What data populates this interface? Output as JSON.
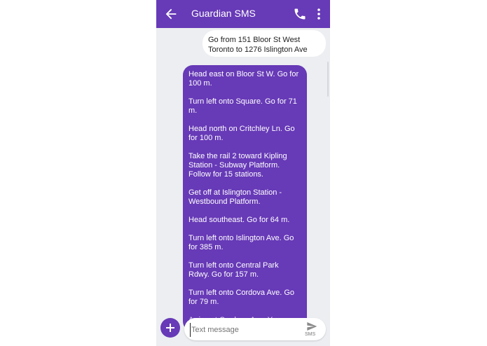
{
  "app": {
    "title": "Guardian SMS"
  },
  "thread": {
    "outgoing_message": "Go from 151 Bloor St West Toronto to 1276 Islington Ave",
    "incoming_steps": [
      "Head east on Bloor St W. Go for 100 m.",
      "Turn left onto Square. Go for 71 m.",
      "Head north on Critchley Ln. Go for 100 m.",
      "Take the rail 2 toward Kipling Station - Subway Platform. Follow for 15 stations.",
      "Get off at Islington Station - Westbound Platform.",
      "Head southeast. Go for 64 m.",
      "Turn left onto Islington Ave. Go for 385 m.",
      "Turn left onto Central Park Rdwy. Go for 157 m.",
      "Turn left onto Cordova Ave. Go for 79 m.",
      "Arrive at Cordova Ave. Your"
    ]
  },
  "composer": {
    "placeholder": "Text message",
    "value": "",
    "send_label": "SMS"
  },
  "colors": {
    "accent": "#673ab7",
    "background": "#eceef1",
    "bubble_out": "#ffffff"
  }
}
